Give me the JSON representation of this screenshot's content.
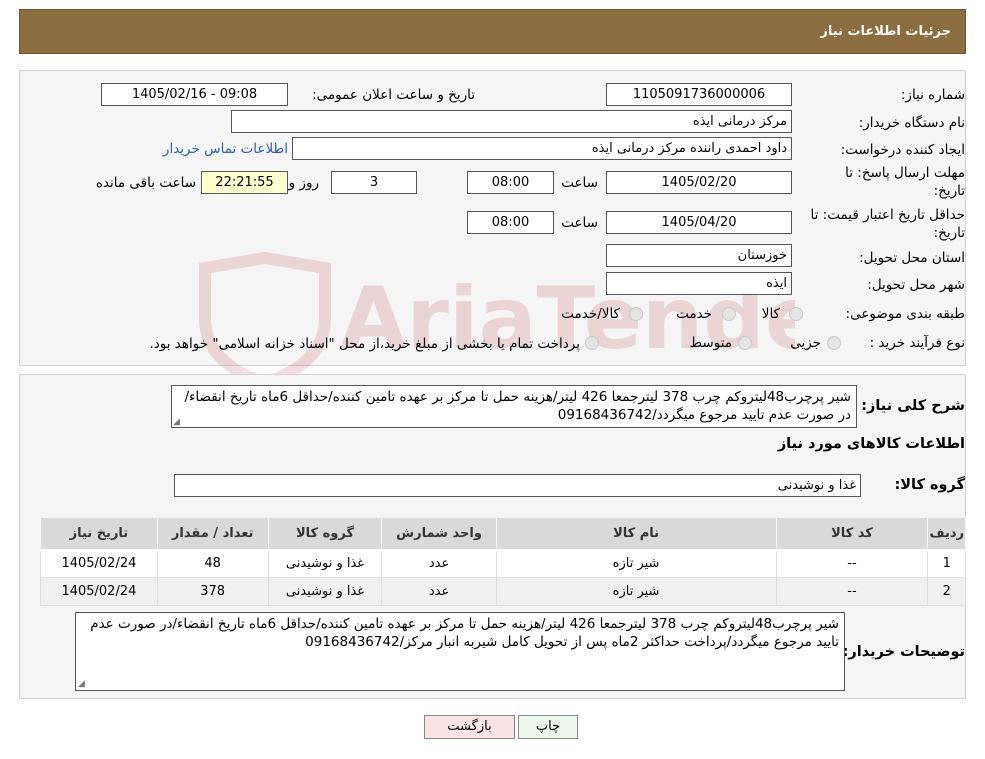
{
  "header": {
    "title": "جزئیات اطلاعات نیاز"
  },
  "form": {
    "need_number_label": "شماره نیاز:",
    "need_number": "1105091736000006",
    "announce_label": "تاریخ و ساعت اعلان عمومی:",
    "announce_value": "1405/02/16 - 09:08",
    "buyer_name_label": "نام دستگاه خریدار:",
    "buyer_name": "مرکز درمانی ایذه",
    "creator_label": "ایجاد کننده درخواست:",
    "creator": "داود احمدی راننده مرکز درمانی ایذه",
    "contact_link": "اطلاعات تماس خریدار",
    "deadline_label_1": "مهلت ارسال پاسخ: تا",
    "deadline_label_2": "تاریخ:",
    "deadline_date": "1405/02/20",
    "time_label": "ساعت",
    "deadline_time": "08:00",
    "days_value": "3",
    "days_label": "روز و",
    "remaining_time": "22:21:55",
    "remaining_label": "ساعت باقی مانده",
    "validity_label_1": "حداقل تاریخ اعتبار قیمت: تا",
    "validity_label_2": "تاریخ:",
    "validity_date": "1405/04/20",
    "validity_time": "08:00",
    "province_label": "استان محل تحویل:",
    "province": "خوزستان",
    "city_label": "شهر محل تحویل:",
    "city": "ایذه",
    "category_label": "طبقه بندی موضوعی:",
    "category_options": [
      "کالا",
      "خدمت",
      "کالا/خدمت"
    ],
    "process_label": "نوع فرآیند خرید :",
    "process_options": [
      "جزیی",
      "متوسط"
    ],
    "process_note": "پرداخت تمام یا بخشی از مبلغ خرید،از محل \"اسناد خزانه اسلامی\" خواهد بود."
  },
  "details": {
    "summary_label": "شرح کلی نیاز:",
    "summary": "شیر پرچرب48لیتروکم چرب  378 لیترجمعا 426 لیتر/هزینه حمل تا مرکز بر عهده تامین کننده/حداقل 6ماه تاریخ انقضاء/در صورت عدم تایید مرجوع میگردد/09168436742",
    "goods_info_title": "اطلاعات کالاهای مورد نیاز",
    "group_label": "گروه کالا:",
    "group_value": "غذا و نوشیدنی",
    "table": {
      "headers": [
        "ردیف",
        "کد کالا",
        "نام کالا",
        "واحد شمارش",
        "گروه کالا",
        "تعداد / مقدار",
        "تاریخ نیاز"
      ],
      "rows": [
        [
          "1",
          "--",
          "شیر تازه",
          "عدد",
          "غذا و نوشیدنی",
          "48",
          "1405/02/24"
        ],
        [
          "2",
          "--",
          "شیر تازه",
          "عدد",
          "غذا و نوشیدنی",
          "378",
          "1405/02/24"
        ]
      ]
    },
    "buyer_notes_label": "توضیحات خریدار:",
    "buyer_notes": "شیر پرچرب48لیتروکم چرب  378 لیترجمعا 426 لیتر/هزینه حمل تا مرکز بر عهده تامین کننده/حداقل 6ماه تاریخ انقضاء/در صورت عدم تایید مرجوع میگردد/پرداخت حداکثر 2ماه پس از تحویل کامل شیربه انبار مرکز/09168436742"
  },
  "buttons": {
    "print": "چاپ",
    "back": "بازگشت"
  },
  "watermark": {
    "text": "AriaTender.neT"
  },
  "colors": {
    "header_bg": "#8c6d3f",
    "link": "#2a5db0",
    "back_button": "#fbe3e3",
    "print_button": "#eaf8ea"
  }
}
